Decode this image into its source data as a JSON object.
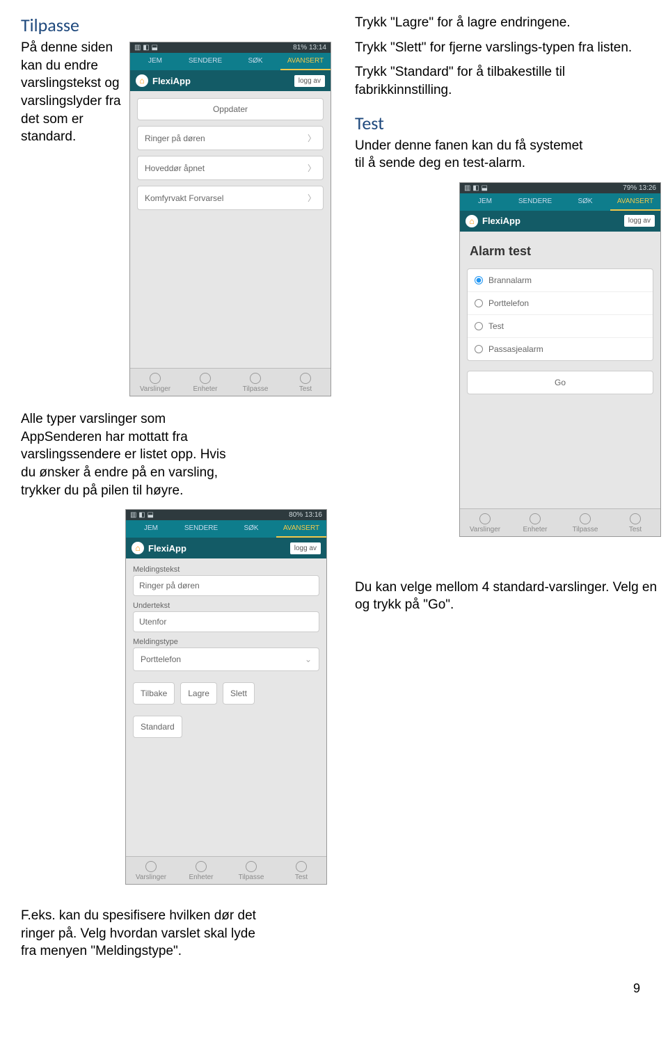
{
  "left": {
    "tilpasse_heading": "Tilpasse",
    "tilpasse_body": "På denne siden kan du endre varslingstekst og varslingslyder fra det\nsom er\nstandard.",
    "para2": "Alle typer varslinger som AppSenderen har mottatt fra varslingssendere er listet opp.\nHvis du ønsker å endre på en varsling, trykker du på pilen til høyre.",
    "para3": "F.eks. kan du spesifisere hvilken dør det ringer på.\nVelg hvordan varslet skal lyde fra menyen \"Meldingstype\"."
  },
  "right": {
    "p1": "Trykk \"Lagre\" for å lagre endringene.",
    "p2": "Trykk \"Slett\" for fjerne varslings-typen fra listen.",
    "p3": "Trykk \"Standard\" for å tilbakestille til fabrikkinnstilling.",
    "test_heading": "Test",
    "test_body": "Under denne fanen kan du få systemet til å sende deg en test-alarm.",
    "p4": "Du kan velge mellom 4 standard-varslinger.\nVelg en og trykk på \"Go\"."
  },
  "phone1": {
    "status_left": "",
    "status_right": "81%   13:14",
    "tabs": [
      "JEM",
      "SENDERE",
      "SØK",
      "AVANSERT"
    ],
    "title": "FlexiApp",
    "logoff": "logg av",
    "update": "Oppdater",
    "items": [
      "Ringer på døren",
      "Hoveddør åpnet",
      "Komfyrvakt Forvarsel"
    ],
    "footer": [
      "Varslinger",
      "Enheter",
      "Tilpasse",
      "Test"
    ]
  },
  "phone2": {
    "status_right": "80%   13:16",
    "tabs": [
      "JEM",
      "SENDERE",
      "SØK",
      "AVANSERT"
    ],
    "title": "FlexiApp",
    "logoff": "logg av",
    "label_meldingstekst": "Meldingstekst",
    "val_meldingstekst": "Ringer på døren",
    "label_undertekst": "Undertekst",
    "val_undertekst": "Utenfor",
    "label_meldingstype": "Meldingstype",
    "val_meldingstype": "Porttelefon",
    "btns": [
      "Tilbake",
      "Lagre",
      "Slett"
    ],
    "btn_standard": "Standard",
    "footer": [
      "Varslinger",
      "Enheter",
      "Tilpasse",
      "Test"
    ]
  },
  "phone3": {
    "status_right": "79%   13:26",
    "tabs": [
      "JEM",
      "SENDERE",
      "SØK",
      "AVANSERT"
    ],
    "title": "FlexiApp",
    "logoff": "logg av",
    "card_title": "Alarm test",
    "options": [
      "Brannalarm",
      "Porttelefon",
      "Test",
      "Passasjealarm"
    ],
    "go": "Go",
    "footer": [
      "Varslinger",
      "Enheter",
      "Tilpasse",
      "Test"
    ]
  },
  "pagenum": "9"
}
